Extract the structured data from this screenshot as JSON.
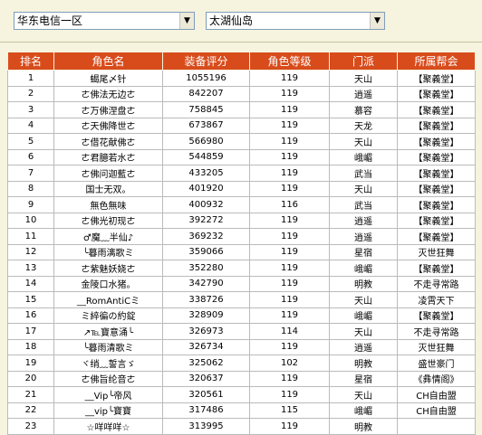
{
  "filters": {
    "region": "华东电信一区",
    "server": "太湖仙岛"
  },
  "colors": {
    "header_bg": "#d84c1c",
    "header_text": "#ffffff",
    "page_bg": "#f6f3de"
  },
  "table": {
    "headers": [
      "排名",
      "角色名",
      "装备评分",
      "角色等级",
      "门派",
      "所属帮会"
    ],
    "rows": [
      [
        "1",
        "蝎尾〆针",
        "1055196",
        "119",
        "天山",
        "【聚義堂】"
      ],
      [
        "2",
        "ㄜ佛法无边ㄜ",
        "842207",
        "119",
        "逍遥",
        "【聚義堂】"
      ],
      [
        "3",
        "ㄜ万佛涅盘ㄜ",
        "758845",
        "119",
        "慕容",
        "【聚義堂】"
      ],
      [
        "4",
        "ㄜ天佛降世ㄜ",
        "673867",
        "119",
        "天龙",
        "【聚義堂】"
      ],
      [
        "5",
        "ㄜ借花献佛ㄜ",
        "566980",
        "119",
        "天山",
        "【聚義堂】"
      ],
      [
        "6",
        "ㄜ君臆若水ㄜ",
        "544859",
        "119",
        "峨嵋",
        "【聚義堂】"
      ],
      [
        "7",
        "ㄜ佛问迦藍ㄜ",
        "433205",
        "119",
        "武当",
        "【聚義堂】"
      ],
      [
        "8",
        "国士无双。",
        "401920",
        "119",
        "天山",
        "【聚義堂】"
      ],
      [
        "9",
        "無色無味",
        "400932",
        "116",
        "武当",
        "【聚義堂】"
      ],
      [
        "10",
        "ㄜ佛光初现ㄜ",
        "392272",
        "119",
        "逍遥",
        "【聚義堂】"
      ],
      [
        "11",
        "♂魔﹏半仙♪",
        "369232",
        "119",
        "逍遥",
        "【聚義堂】"
      ],
      [
        "12",
        "╰暮雨漓歌ミ",
        "359066",
        "119",
        "星宿",
        "灭世狂舞"
      ],
      [
        "13",
        "ㄜ紫魅妖娆ㄜ",
        "352280",
        "119",
        "峨嵋",
        "【聚義堂】"
      ],
      [
        "14",
        "金陵口水猪。",
        "342790",
        "119",
        "明教",
        "不走寻常路"
      ],
      [
        "15",
        "__RomAntiCミ",
        "338726",
        "119",
        "天山",
        "凌霄天下"
      ],
      [
        "16",
        "ミ綷徧の約錠",
        "328909",
        "119",
        "峨嵋",
        "【聚義堂】"
      ],
      [
        "17",
        "↗℡寶意涌╰",
        "326973",
        "114",
        "天山",
        "不走寻常路"
      ],
      [
        "18",
        "╰暮雨清歌ミ",
        "326734",
        "119",
        "逍遥",
        "灭世狂舞"
      ],
      [
        "19",
        "ヾ绡﹏誓言ゞ",
        "325062",
        "102",
        "明教",
        "盛世豪门"
      ],
      [
        "20",
        "ㄜ佛旨纶音ㄜ",
        "320637",
        "119",
        "星宿",
        "《彝情阁》"
      ],
      [
        "21",
        "__Vip╰帝风",
        "320561",
        "119",
        "天山",
        "CH自由盟"
      ],
      [
        "22",
        "__vip╰寶寶",
        "317486",
        "115",
        "峨嵋",
        "CH自由盟"
      ],
      [
        "23",
        "☆咩咩咩☆",
        "313995",
        "119",
        "明教",
        ""
      ]
    ]
  }
}
